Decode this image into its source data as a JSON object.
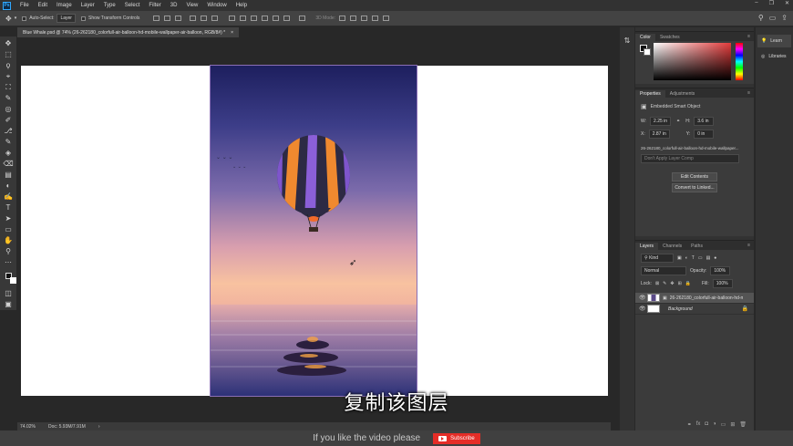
{
  "menubar": {
    "logo": "Ps",
    "items": [
      "File",
      "Edit",
      "Image",
      "Layer",
      "Type",
      "Select",
      "Filter",
      "3D",
      "View",
      "Window",
      "Help"
    ],
    "window_controls": [
      "–",
      "❐",
      "✕"
    ]
  },
  "options": {
    "auto_select_label": "Auto-Select:",
    "auto_select_value": "Layer",
    "transform_controls_label": "Show Transform Controls",
    "mode_3d_label": "3D Mode:"
  },
  "document": {
    "tab_title": "Blue Whale.psd @ 74% (26-262180_colorfull-air-balloon-hd-mobile-wallpaper-air-balloon, RGB/8#) *",
    "close": "×"
  },
  "status": {
    "zoom": "74.02%",
    "doc_size": "Doc: 5.93M/7.91M",
    "arrow": "›"
  },
  "tools": [
    "✥",
    "⬚",
    "ϙ",
    "⌖",
    "⛶",
    "✎",
    "◎",
    "✐",
    "⎇",
    "✎",
    "◈",
    "⌫",
    "▤",
    "◐",
    "✍",
    "T",
    "➤",
    "▭",
    "✋",
    "⚲",
    "⋯"
  ],
  "panels": {
    "color": {
      "tab_active": "Color",
      "tab_other": "Swatches"
    },
    "properties": {
      "tab_active": "Properties",
      "tab_other": "Adjustments",
      "heading": "Embedded Smart Object",
      "w_label": "W:",
      "w_value": "2.25 in",
      "h_label": "H:",
      "h_value": "3.6 in",
      "x_label": "X:",
      "x_value": "2.87 in",
      "y_label": "Y:",
      "y_value": "0 in",
      "filename": "26-262180_colorfull-air-balloon-hd-mobile-wallpaper...",
      "comp_placeholder": "Don't Apply Layer Comp",
      "edit_contents": "Edit Contents",
      "convert_linked": "Convert to Linked..."
    },
    "layers": {
      "tabs": [
        "Layers",
        "Channels",
        "Paths"
      ],
      "kind_label": "Kind",
      "blend_mode": "Normal",
      "opacity_label": "Opacity:",
      "opacity_value": "100%",
      "lock_label": "Lock:",
      "fill_label": "Fill:",
      "fill_value": "100%",
      "rows": [
        {
          "name": "26-262180_colorfull-air-balloon-hd-m...",
          "selected": true
        },
        {
          "name": "Background",
          "selected": false
        }
      ],
      "footer_icons": [
        "⚭",
        "fx",
        "◘",
        "◑",
        "▭",
        "⊞",
        "🗑"
      ]
    }
  },
  "right_column": {
    "learn_label": "Learn",
    "libraries_label": "Libraries"
  },
  "overlay": {
    "subtitle": "复制该图层",
    "promo_text": "If you like the video please",
    "subscribe_label": "Subscribe"
  }
}
